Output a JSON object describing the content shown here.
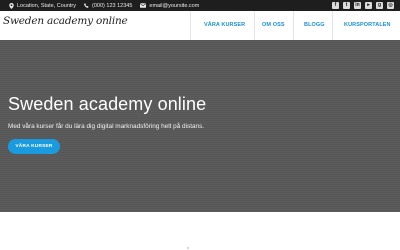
{
  "topbar": {
    "location": "Location, State, Country",
    "phone": "(000) 123 12345",
    "email": "email@yoursite.com",
    "social_icons": [
      "facebook-icon",
      "twitter-icon",
      "linkedin-icon",
      "youtube-icon",
      "google-plus-icon",
      "instagram-icon"
    ]
  },
  "header": {
    "logo_text": "Sweden academy online",
    "nav": [
      {
        "label": "VÅRA KURSER"
      },
      {
        "label": "OM OSS"
      },
      {
        "label": "BLOGG"
      },
      {
        "label": "KURSPORTALEN"
      }
    ]
  },
  "hero": {
    "title": "Sweden academy online",
    "subtitle": "Med våra kurser får du lära dig digital marknadsföring helt på distans.",
    "cta_label": "VÅRA KURSER"
  },
  "colors": {
    "accent": "#1a9be0",
    "topbar_bg": "#1e1e1e",
    "hero_bg": "#575757"
  }
}
